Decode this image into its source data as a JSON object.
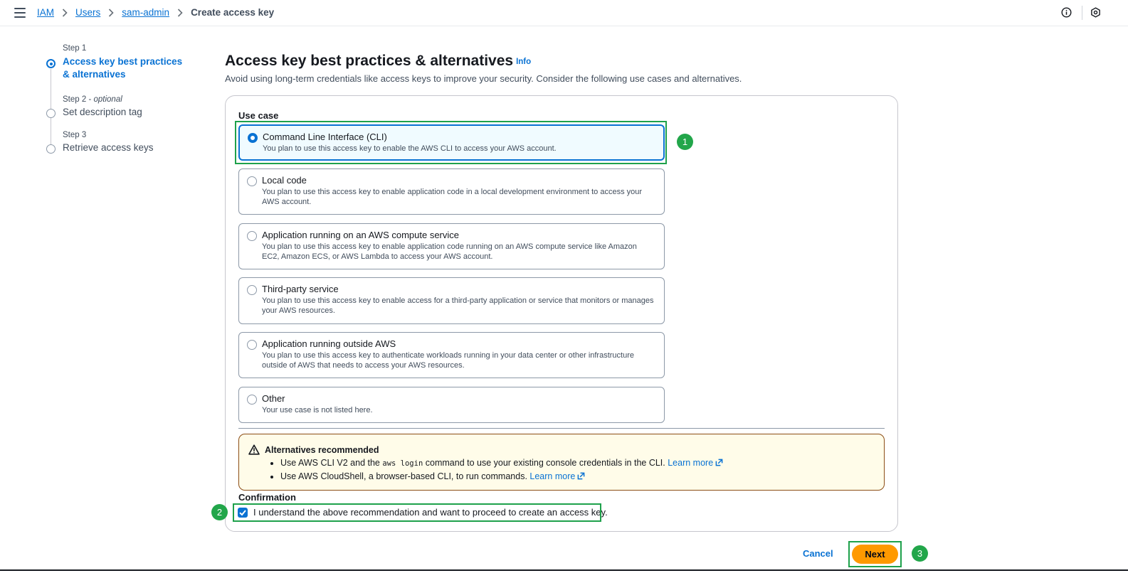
{
  "breadcrumb": {
    "items": [
      "IAM",
      "Users",
      "sam-admin"
    ],
    "current": "Create access key"
  },
  "steps": [
    {
      "num": "Step 1",
      "optional": "",
      "title": "Access key best practices & alternatives",
      "active": true
    },
    {
      "num": "Step 2",
      "optional": "optional",
      "title": "Set description tag",
      "active": false
    },
    {
      "num": "Step 3",
      "optional": "",
      "title": "Retrieve access keys",
      "active": false
    }
  ],
  "page": {
    "title": "Access key best practices & alternatives",
    "info_link": "Info",
    "subtitle": "Avoid using long-term credentials like access keys to improve your security. Consider the following use cases and alternatives."
  },
  "use_case": {
    "label": "Use case",
    "selected_index": 0,
    "options": [
      {
        "title": "Command Line Interface (CLI)",
        "desc": "You plan to use this access key to enable the AWS CLI to access your AWS account."
      },
      {
        "title": "Local code",
        "desc": "You plan to use this access key to enable application code in a local development environment to access your AWS account."
      },
      {
        "title": "Application running on an AWS compute service",
        "desc": "You plan to use this access key to enable application code running on an AWS compute service like Amazon EC2, Amazon ECS, or AWS Lambda to access your AWS account."
      },
      {
        "title": "Third-party service",
        "desc": "You plan to use this access key to enable access for a third-party application or service that monitors or manages your AWS resources."
      },
      {
        "title": "Application running outside AWS",
        "desc": "You plan to use this access key to authenticate workloads running in your data center or other infrastructure outside of AWS that needs to access your AWS resources."
      },
      {
        "title": "Other",
        "desc": "Your use case is not listed here."
      }
    ]
  },
  "alert": {
    "title": "Alternatives recommended",
    "item1_pre": "Use AWS CLI V2 and the",
    "item1_code": "aws login",
    "item1_post": "command to use your existing console credentials in the CLI.",
    "item2_text": "Use AWS CloudShell, a browser-based CLI, to run commands.",
    "learn_more": "Learn more"
  },
  "confirmation": {
    "label": "Confirmation",
    "checkbox_text": "I understand the above recommendation and want to proceed to create an access key.",
    "checked": true
  },
  "footer": {
    "cancel": "Cancel",
    "next": "Next"
  },
  "annotations": [
    "1",
    "2",
    "3"
  ],
  "colors": {
    "accent": "#0972d3",
    "primary_button": "#ff9900",
    "annotation": "#22a64a",
    "warning_border": "#8c4d15"
  }
}
